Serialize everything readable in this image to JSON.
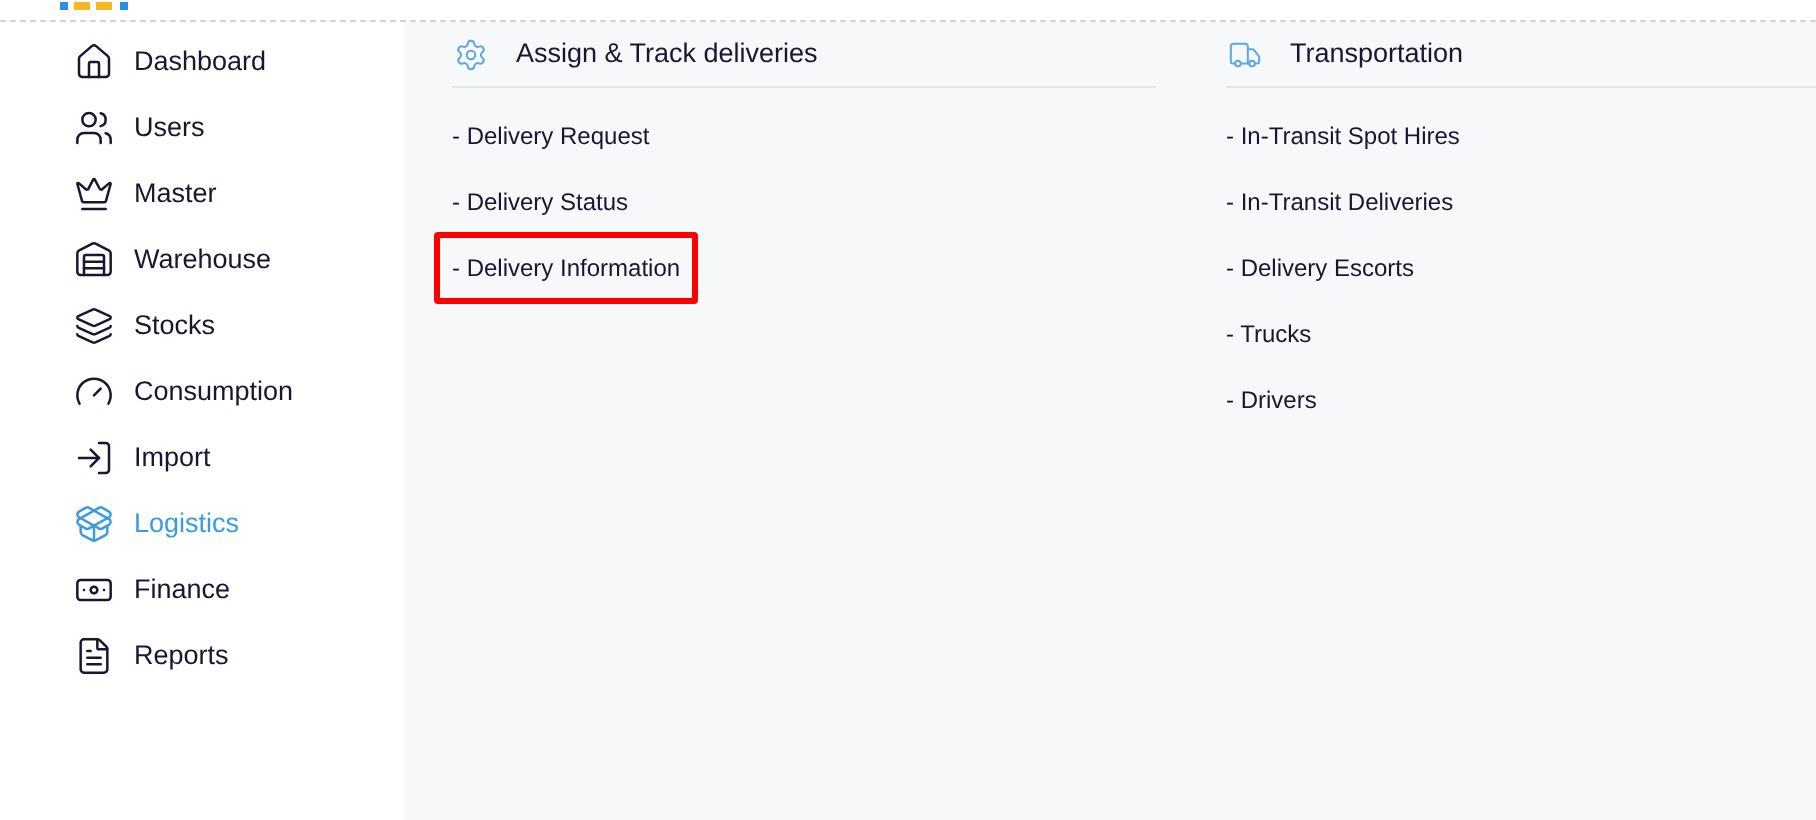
{
  "sidebar": {
    "items": [
      {
        "label": "Dashboard",
        "selected": false
      },
      {
        "label": "Users",
        "selected": false
      },
      {
        "label": "Master",
        "selected": false
      },
      {
        "label": "Warehouse",
        "selected": false
      },
      {
        "label": "Stocks",
        "selected": false
      },
      {
        "label": "Consumption",
        "selected": false
      },
      {
        "label": "Import",
        "selected": false
      },
      {
        "label": "Logistics",
        "selected": true
      },
      {
        "label": "Finance",
        "selected": false
      },
      {
        "label": "Reports",
        "selected": false
      }
    ]
  },
  "sections": [
    {
      "title": "Assign & Track deliveries",
      "items": [
        {
          "label": "- Delivery Request",
          "highlighted": false
        },
        {
          "label": "- Delivery Status",
          "highlighted": false
        },
        {
          "label": "- Delivery Information",
          "highlighted": true
        }
      ]
    },
    {
      "title": "Transportation",
      "items": [
        {
          "label": "- In-Transit Spot Hires",
          "highlighted": false
        },
        {
          "label": "- In-Transit Deliveries",
          "highlighted": false
        },
        {
          "label": "- Delivery Escorts",
          "highlighted": false
        },
        {
          "label": "- Trucks",
          "highlighted": false
        },
        {
          "label": "- Drivers",
          "highlighted": false
        }
      ]
    }
  ]
}
